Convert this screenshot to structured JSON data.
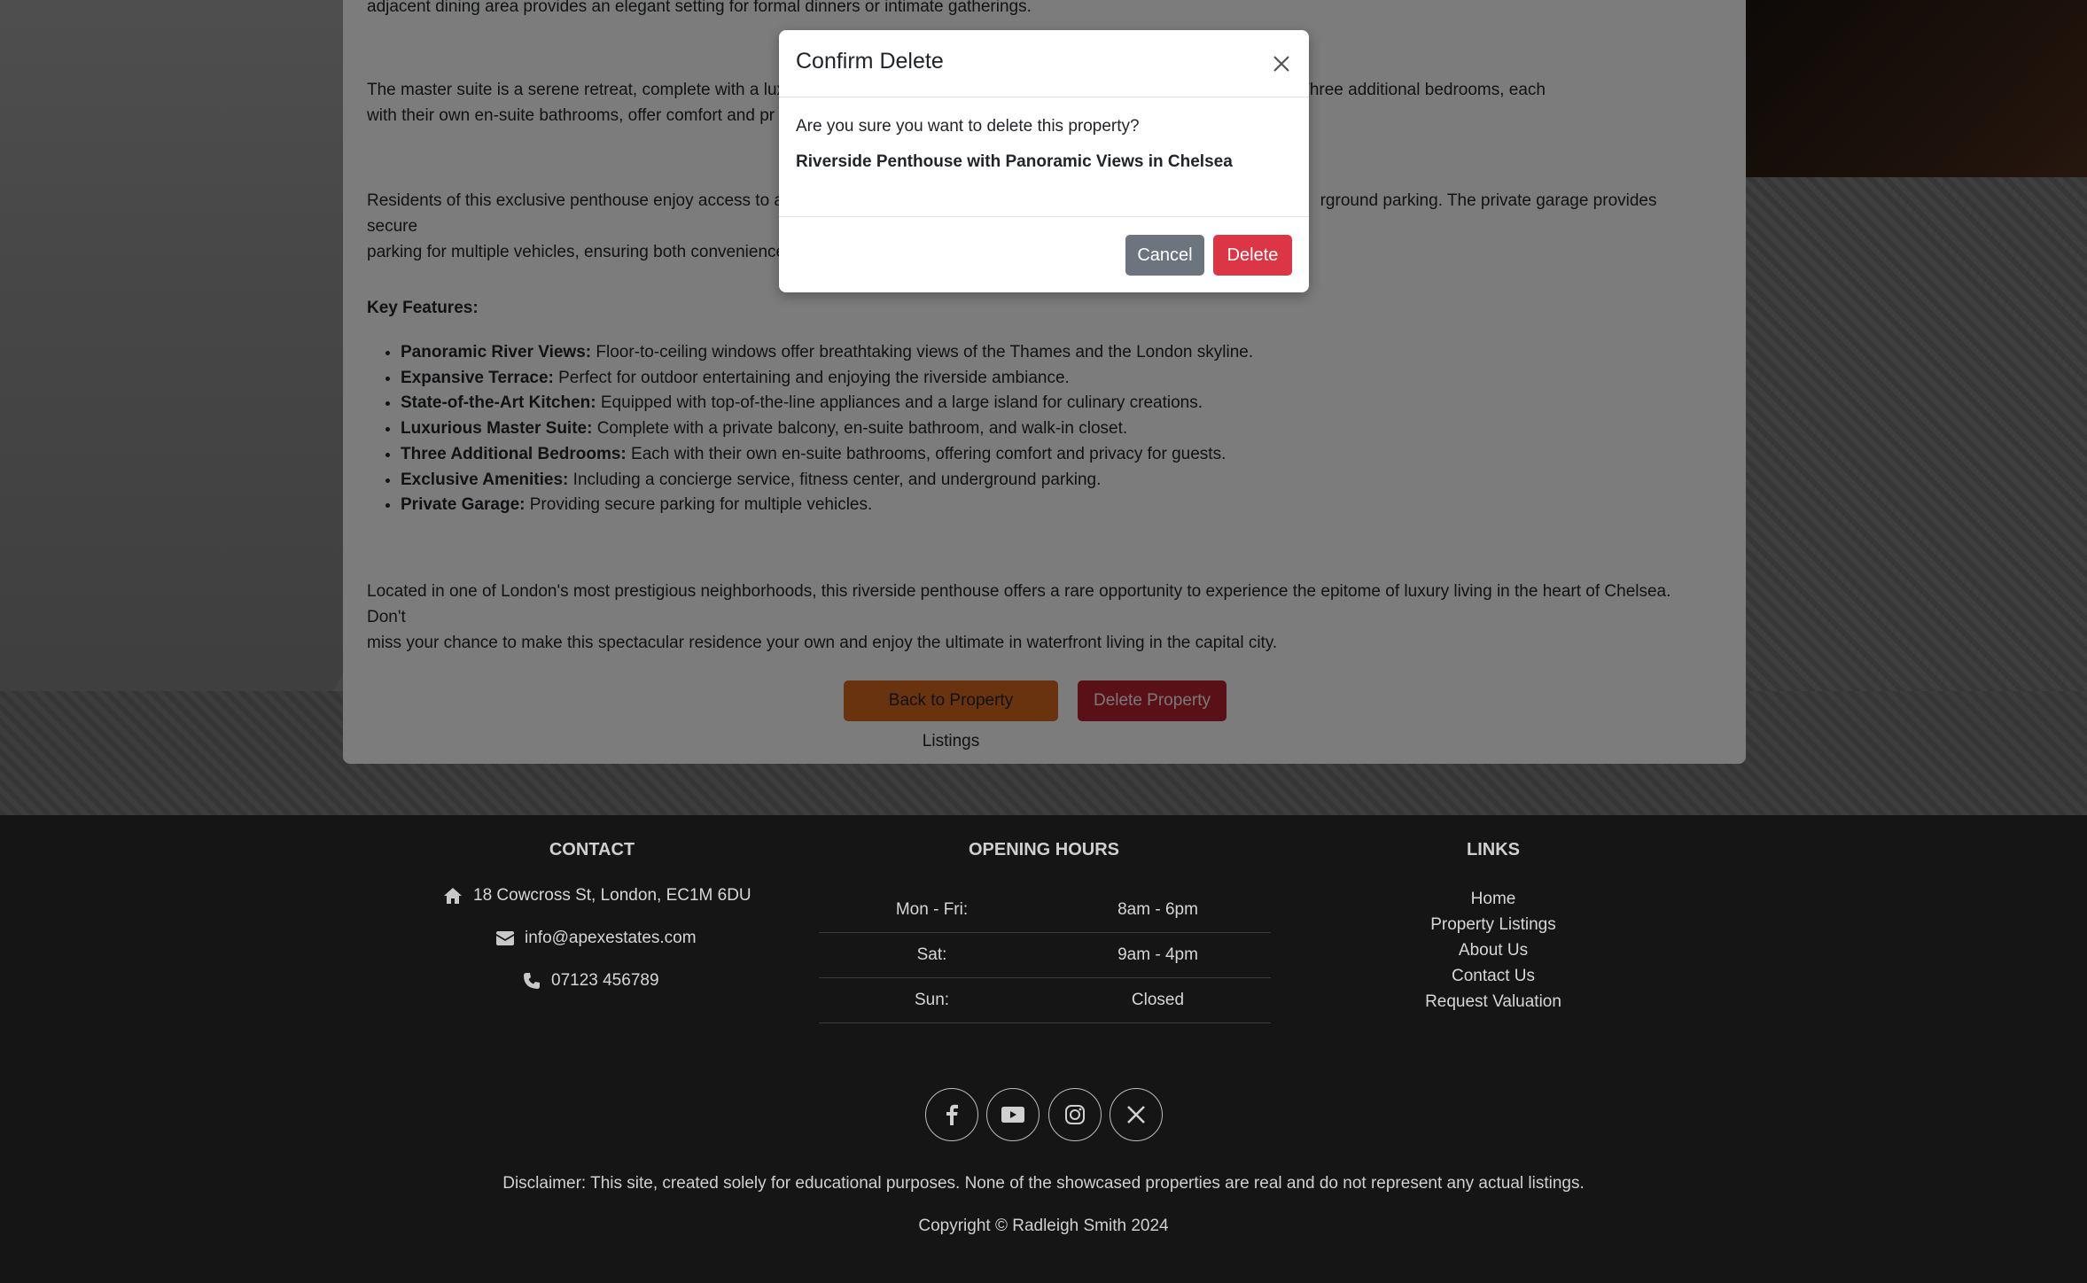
{
  "content": {
    "intro_tail": "adjacent dining area provides an elegant setting for formal dinners or intimate gatherings.",
    "master_suite_left": "The master suite is a serene retreat, complete with a lux",
    "master_suite_right": "ous walk-in closet. Three additional bedrooms, each",
    "master_suite_line2": "with their own en-suite bathrooms, offer comfort and pr",
    "amenities_left": "Residents of this exclusive penthouse enjoy access to a r",
    "amenities_right": "rground parking. The private garage provides secure",
    "amenities_line2": "parking for multiple vehicles, ensuring both convenience",
    "features_title": "Key Features:",
    "features": [
      {
        "label": "Panoramic River Views:",
        "text": " Floor-to-ceiling windows offer breathtaking views of the Thames and the London skyline."
      },
      {
        "label": "Expansive Terrace:",
        "text": " Perfect for outdoor entertaining and enjoying the riverside ambiance."
      },
      {
        "label": "State-of-the-Art Kitchen:",
        "text": " Equipped with top-of-the-line appliances and a large island for culinary creations."
      },
      {
        "label": "Luxurious Master Suite:",
        "text": " Complete with a private balcony, en-suite bathroom, and walk-in closet."
      },
      {
        "label": "Three Additional Bedrooms:",
        "text": " Each with their own en-suite bathrooms, offering comfort and privacy for guests."
      },
      {
        "label": "Exclusive Amenities:",
        "text": " Including a concierge service, fitness center, and underground parking."
      },
      {
        "label": "Private Garage:",
        "text": " Providing secure parking for multiple vehicles."
      }
    ],
    "closing_line1": "Located in one of London's most prestigious neighborhoods, this riverside penthouse offers a rare opportunity to experience the epitome of luxury living in the heart of Chelsea. Don't",
    "closing_line2": "miss your chance to make this spectacular residence your own and enjoy the ultimate in waterfront living in the capital city.",
    "back_button": "Back to Property Listings",
    "delete_property_button": "Delete Property"
  },
  "modal": {
    "title": "Confirm Delete",
    "question": "Are you sure you want to delete this property?",
    "property_name": "Riverside Penthouse with Panoramic Views in Chelsea",
    "cancel_label": "Cancel",
    "delete_label": "Delete"
  },
  "footer": {
    "contact_title": "CONTACT",
    "address": "18 Cowcross St, London, EC1M 6DU",
    "email": "info@apexestates.com",
    "phone": "07123 456789",
    "hours_title": "OPENING HOURS",
    "hours": [
      {
        "day": "Mon - Fri:",
        "time": "8am - 6pm"
      },
      {
        "day": "Sat:",
        "time": "9am - 4pm"
      },
      {
        "day": "Sun:",
        "time": "Closed"
      }
    ],
    "links_title": "LINKS",
    "links": [
      "Home",
      "Property Listings",
      "About Us",
      "Contact Us",
      "Request Valuation"
    ],
    "social_icons": [
      "facebook-icon",
      "youtube-icon",
      "instagram-icon",
      "x-icon"
    ],
    "disclaimer": "Disclaimer: This site, created solely for educational purposes. None of the showcased properties are real and do not represent any actual listings.",
    "copyright": "Copyright © Radleigh Smith 2024"
  },
  "colors": {
    "back_button": "#d5671f",
    "delete_property_button": "#b5202f",
    "modal_delete": "#dc3545",
    "modal_cancel": "#6c757d",
    "footer_bg": "#151515"
  }
}
